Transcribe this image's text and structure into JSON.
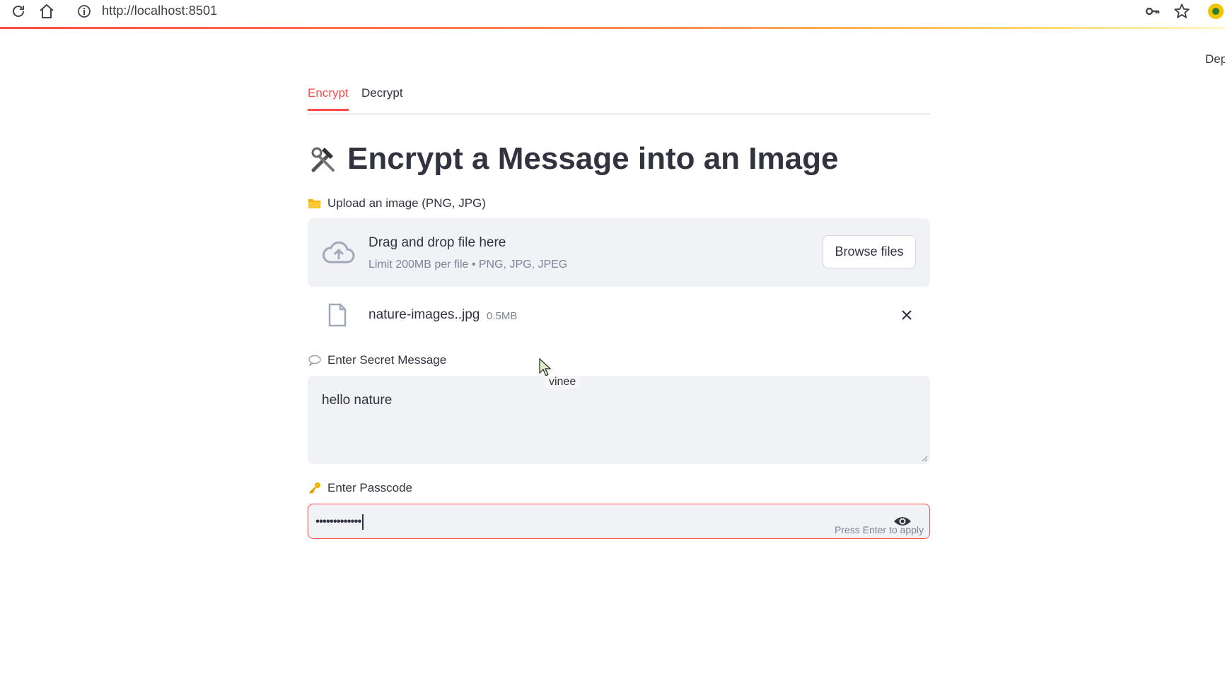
{
  "browser": {
    "url": "http://localhost:8501",
    "icons": [
      "reload-icon",
      "home-icon",
      "info-icon",
      "key-icon",
      "star-icon",
      "extension-icon"
    ]
  },
  "header": {
    "deploy_label": "Dep"
  },
  "tabs": [
    {
      "label": "Encrypt",
      "active": true
    },
    {
      "label": "Decrypt",
      "active": false
    }
  ],
  "main": {
    "title": "Encrypt a Message into an Image",
    "title_icon": "hammer-wrench-icon",
    "upload": {
      "label": "Upload an image (PNG, JPG)",
      "label_icon": "folder-icon",
      "drop_title": "Drag and drop file here",
      "drop_limit": "Limit 200MB per file • PNG, JPG, JPEG",
      "browse_label": "Browse files",
      "file": {
        "name": "nature-images..jpg",
        "size": "0.5MB"
      }
    },
    "message": {
      "label": "Enter Secret Message",
      "label_icon": "speech-bubble-icon",
      "value": "hello nature",
      "tooltip": "vinee"
    },
    "passcode": {
      "label": "Enter Passcode",
      "label_icon": "key-icon",
      "masked_value": "•••••••••••••",
      "hint": "Press Enter to apply"
    }
  },
  "colors": {
    "accent": "#ff4b4b",
    "text": "#31333f",
    "muted": "#808495",
    "field_bg": "#f0f2f6"
  }
}
